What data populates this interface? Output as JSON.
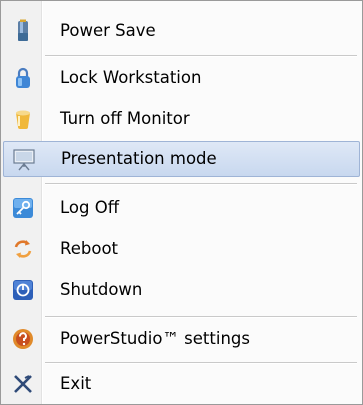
{
  "menu": {
    "items": [
      {
        "label": "Power Save",
        "icon": "battery-icon"
      },
      {
        "label": "Lock Workstation",
        "icon": "lock-icon"
      },
      {
        "label": "Turn off Monitor",
        "icon": "cup-icon"
      },
      {
        "label": "Presentation mode",
        "icon": "presentation-icon",
        "highlighted": true
      },
      {
        "label": "Log Off",
        "icon": "key-icon"
      },
      {
        "label": "Reboot",
        "icon": "reboot-arrows-icon"
      },
      {
        "label": "Shutdown",
        "icon": "power-icon"
      },
      {
        "label": "PowerStudio™ settings",
        "icon": "settings-icon"
      },
      {
        "label": "Exit",
        "icon": "exit-x-icon"
      }
    ],
    "colors": {
      "highlight": "#c8d8ef",
      "highlight_border": "#9fb4d6",
      "gutter": "#f1f1f1"
    }
  }
}
